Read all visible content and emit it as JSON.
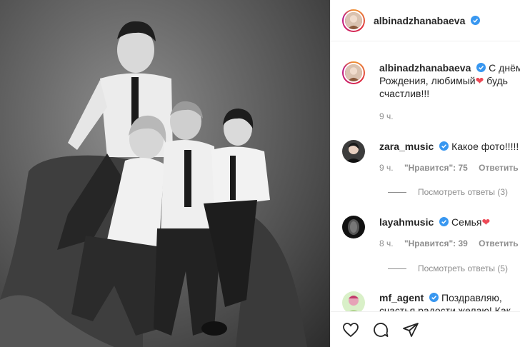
{
  "post": {
    "author": "albinadzhanabaeva"
  },
  "caption": {
    "user": "albinadzhanabaeva",
    "text": "С днём Рождения, любимый",
    "text_after": " будь счастлив!!!",
    "time": "9 ч."
  },
  "comments": [
    {
      "user": "zara_music",
      "text": "Какое фото!!!!!",
      "time": "9 ч.",
      "likes": "\"Нравится\": 75",
      "reply": "Ответить",
      "view_replies": "Посмотреть ответы (3)"
    },
    {
      "user": "layahmusic",
      "text": "Семья",
      "time": "8 ч.",
      "likes": "\"Нравится\": 39",
      "reply": "Ответить",
      "view_replies": "Посмотреть ответы (5)"
    },
    {
      "user": "mf_agent",
      "text": "Поздравляю, счастья радости желаю! Как"
    }
  ],
  "icons": {
    "verified": "verified-badge-icon",
    "like": "heart-icon",
    "comment": "comment-bubble-icon",
    "share": "paper-plane-icon",
    "emoji_heart": "red-heart"
  },
  "colors": {
    "verified": "#3897f0",
    "heart": "#ed4956",
    "muted": "#8e8e8e"
  }
}
